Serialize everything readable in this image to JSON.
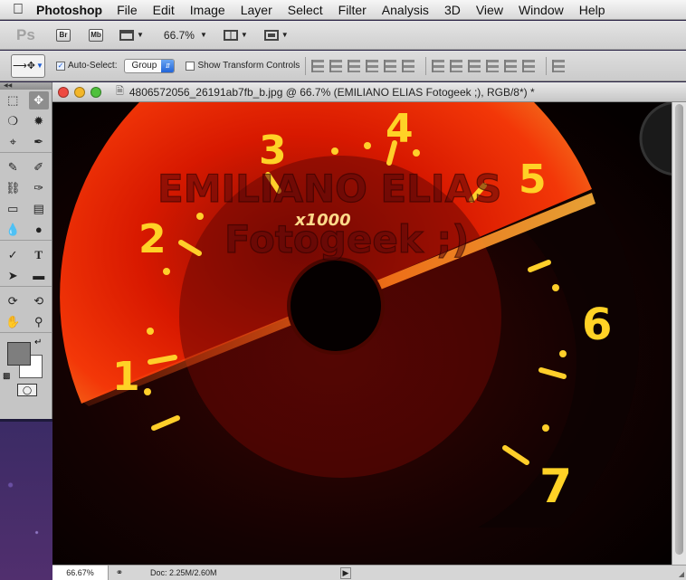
{
  "menubar": {
    "app": "Photoshop",
    "items": [
      "File",
      "Edit",
      "Image",
      "Layer",
      "Select",
      "Filter",
      "Analysis",
      "3D",
      "View",
      "Window",
      "Help"
    ]
  },
  "appbar": {
    "ps": "Ps",
    "br": "Br",
    "mb": "Mb",
    "zoom": "66.7%"
  },
  "options": {
    "auto_select_label": "Auto-Select:",
    "auto_select_checked": true,
    "group_value": "Group",
    "show_transform_label": "Show Transform Controls",
    "show_transform_checked": false
  },
  "document": {
    "title": "4806572056_26191ab7fb_b.jpg @ 66.7% (EMILIANO ELIAS Fotogeek ;), RGB/8*) *"
  },
  "image": {
    "numbers": [
      "1",
      "2",
      "3",
      "4",
      "5",
      "6",
      "7"
    ],
    "multiplier": "x1000",
    "watermark_line1": "EMILIANO ELIAS",
    "watermark_line2": "Fotogeek ;)"
  },
  "status": {
    "zoom": "66.67%",
    "doc_info": "Doc: 2.25M/2.60M"
  },
  "colors": {
    "foreground": "#7e7e7e",
    "background": "#ffffff",
    "gauge_glow": "#ff2a00",
    "numeral": "#ffd226"
  }
}
